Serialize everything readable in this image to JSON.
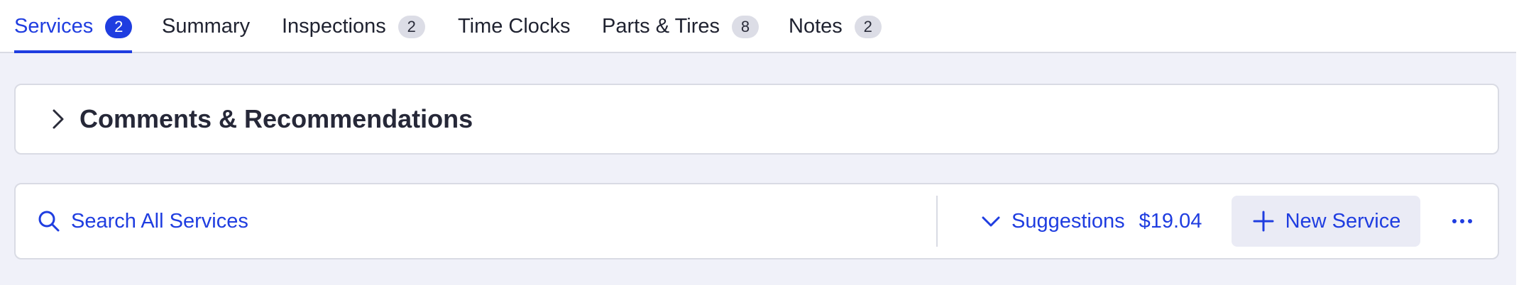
{
  "tabs": [
    {
      "label": "Services",
      "badge": "2",
      "active": true
    },
    {
      "label": "Summary",
      "badge": null,
      "active": false
    },
    {
      "label": "Inspections",
      "badge": "2",
      "active": false
    },
    {
      "label": "Time Clocks",
      "badge": null,
      "active": false
    },
    {
      "label": "Parts & Tires",
      "badge": "8",
      "active": false
    },
    {
      "label": "Notes",
      "badge": "2",
      "active": false
    }
  ],
  "comments_section": {
    "title": "Comments & Recommendations",
    "icon": "chevron-right-icon",
    "expanded": false
  },
  "toolbar": {
    "search_label": "Search All Services",
    "search_icon": "search-icon",
    "suggestions_label": "Suggestions",
    "suggestions_amount": "$19.04",
    "suggestions_icon": "chevron-down-icon",
    "new_service_label": "New Service",
    "new_service_icon": "plus-icon",
    "more_icon": "more-horizontal-icon"
  },
  "colors": {
    "accent": "#1f3de0",
    "badge_inactive": "#dcdde6",
    "content_background": "#f0f1f9",
    "button_background": "#eaebf5",
    "border": "#d9dbe4"
  }
}
